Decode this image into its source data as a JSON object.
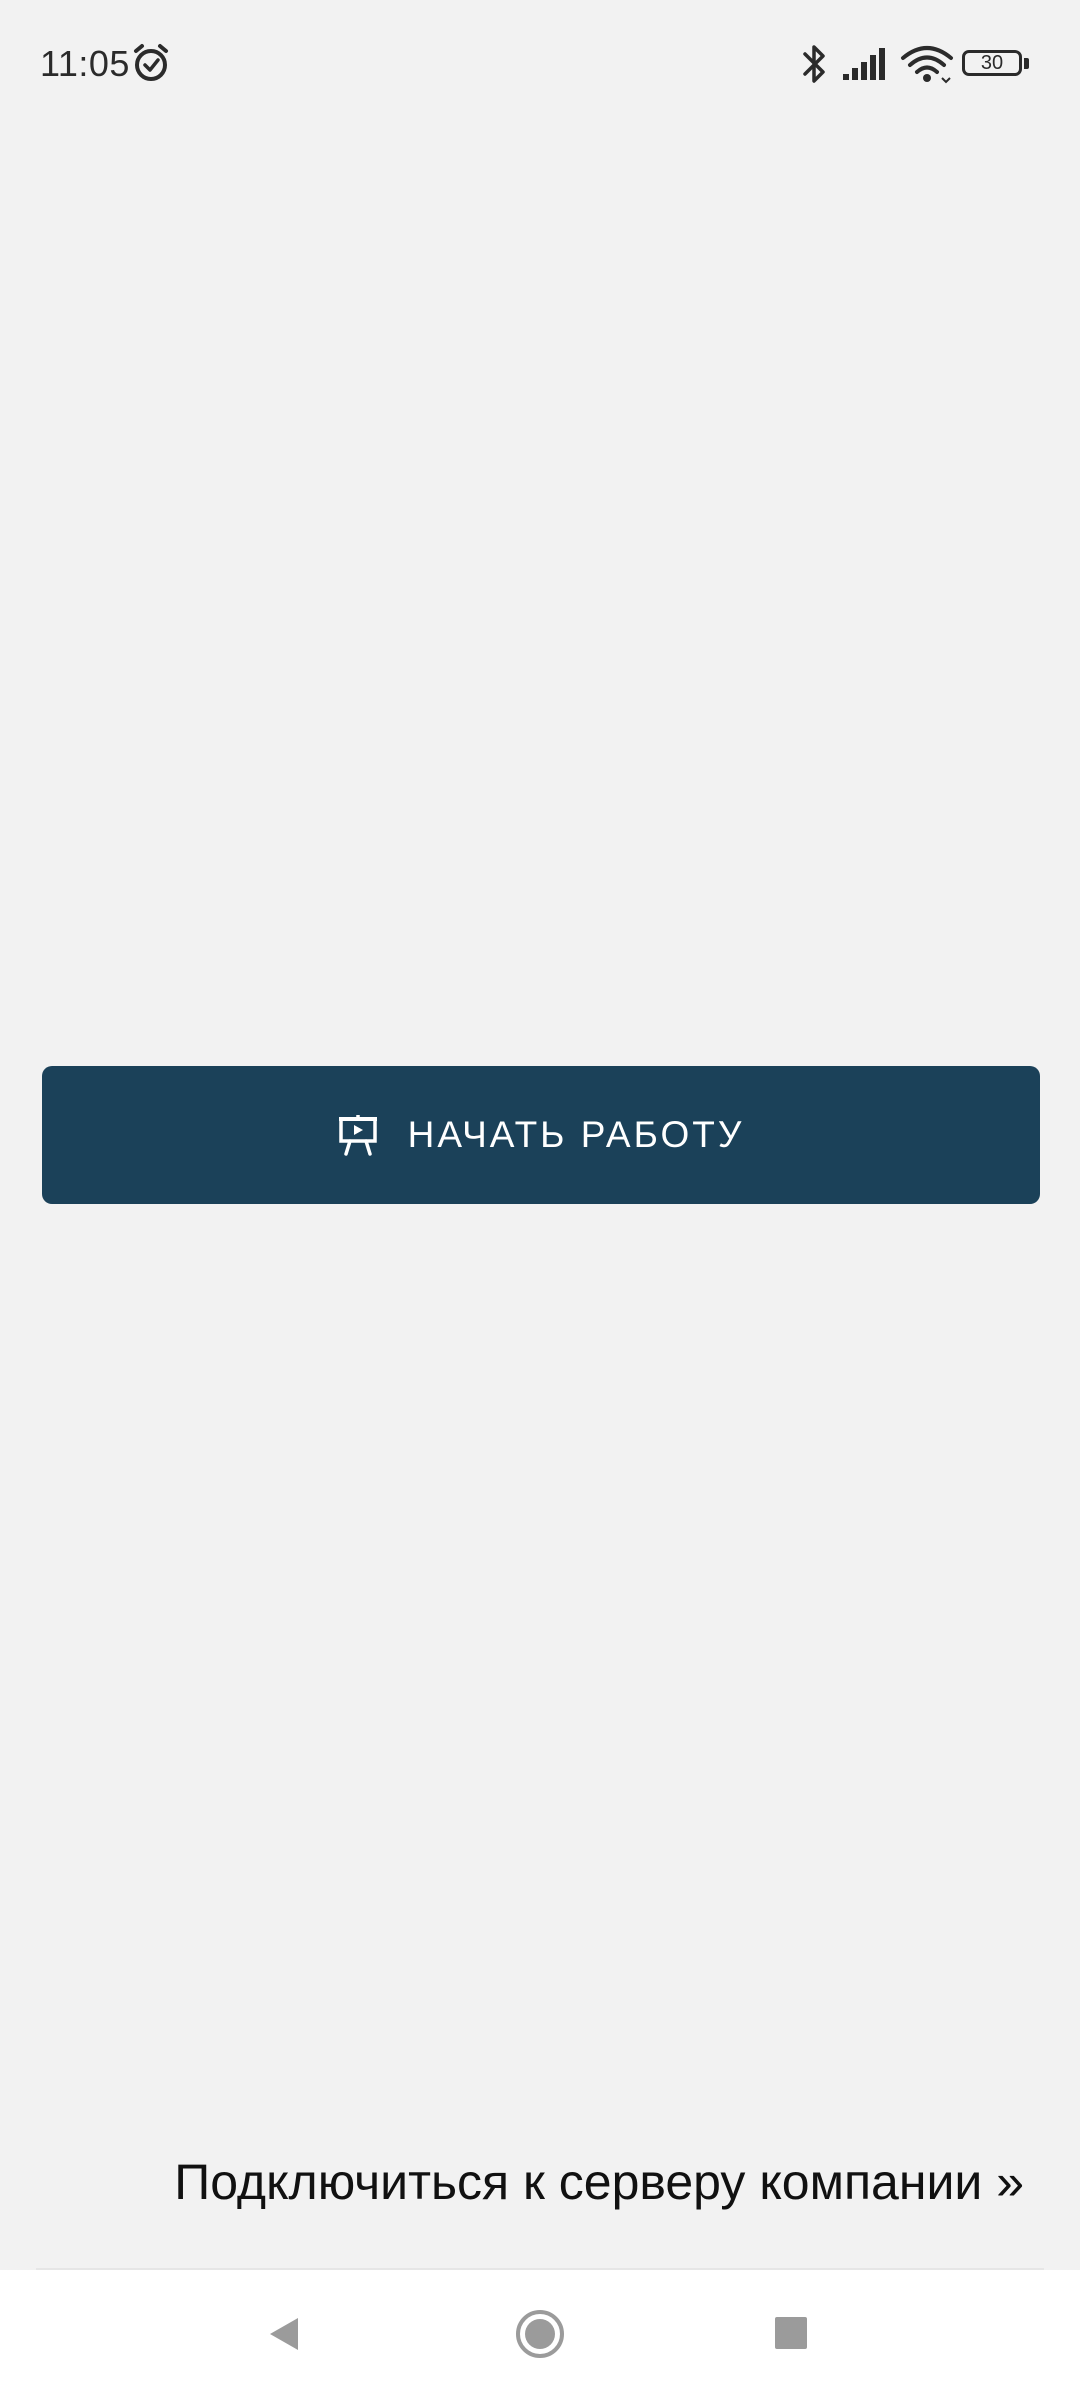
{
  "status_bar": {
    "time": "11:05",
    "battery_level": "30",
    "icons": [
      "alarm-icon",
      "bluetooth-icon",
      "signal-icon",
      "wifi-icon",
      "battery-icon"
    ]
  },
  "main": {
    "start_button": {
      "label": "НАЧАТЬ РАБОТУ",
      "icon": "presentation-icon",
      "color": "#1b4159"
    }
  },
  "footer": {
    "server_link": "Подключиться к серверу компании »"
  },
  "nav_bar": {
    "buttons": [
      "back-icon",
      "home-icon",
      "recents-icon"
    ]
  },
  "colors": {
    "background": "#f2f2f2",
    "accent": "#1b4159",
    "nav_background": "#ffffff"
  }
}
